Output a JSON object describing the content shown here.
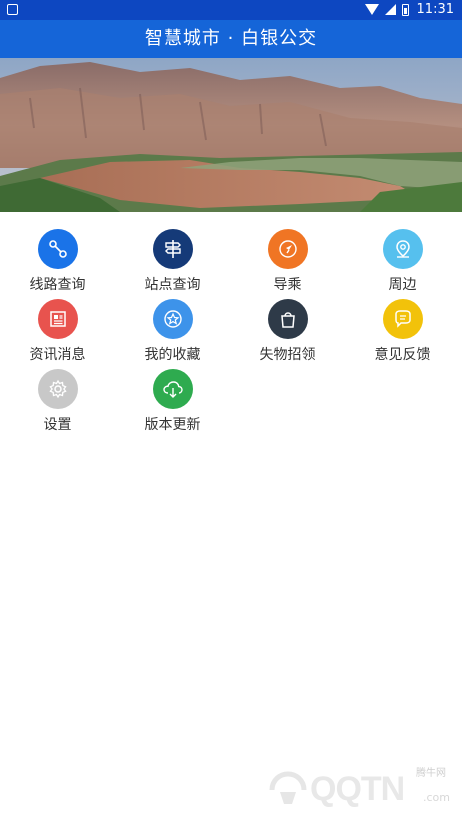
{
  "status_bar": {
    "time": "11:31"
  },
  "app_bar": {
    "title": "智慧城市 · 白银公交"
  },
  "menu": [
    {
      "label": "线路查询",
      "color": "#1a73e8",
      "icon": "route-icon"
    },
    {
      "label": "站点查询",
      "color": "#153a78",
      "icon": "signpost-icon"
    },
    {
      "label": "导乘",
      "color": "#f07524",
      "icon": "navigation-arrow-icon"
    },
    {
      "label": "周边",
      "color": "#56c0ee",
      "icon": "location-pin-icon"
    },
    {
      "label": "资讯消息",
      "color": "#e8534e",
      "icon": "newspaper-icon"
    },
    {
      "label": "我的收藏",
      "color": "#3d93ea",
      "icon": "star-icon"
    },
    {
      "label": "失物招领",
      "color": "#2e3a48",
      "icon": "shopping-bag-icon"
    },
    {
      "label": "意见反馈",
      "color": "#f2c20a",
      "icon": "chat-bubble-icon"
    },
    {
      "label": "设置",
      "color": "#c8c8c8",
      "icon": "gear-icon"
    },
    {
      "label": "版本更新",
      "color": "#2eab4f",
      "icon": "cloud-download-icon"
    }
  ],
  "watermark": {
    "text": "QQTN",
    "small": "腾牛网",
    "domain": ".com"
  }
}
